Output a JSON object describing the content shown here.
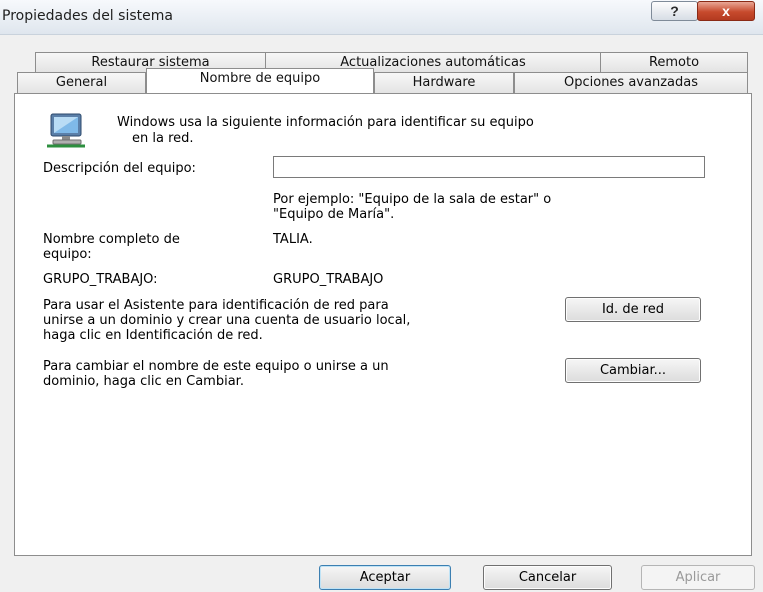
{
  "window": {
    "title": "Propiedades del sistema"
  },
  "title_buttons": {
    "help": "?",
    "close": "x"
  },
  "tabs_top": [
    "Restaurar sistema",
    "Actualizaciones automáticas",
    "Remoto"
  ],
  "tabs_bottom": [
    "General",
    "Nombre de equipo",
    "Hardware",
    "Opciones avanzadas"
  ],
  "active_tab": "Nombre de equipo",
  "intro": {
    "icon": "computer-network-icon",
    "line1": "Windows usa la siguiente información para identificar su equipo",
    "line2": "en la red."
  },
  "description": {
    "label": "Descripción del equipo:",
    "value": "",
    "example_line1": "Por ejemplo: \"Equipo de la sala de estar\" o",
    "example_line2": "\"Equipo de María\"."
  },
  "full_name": {
    "label_line1": "Nombre completo de",
    "label_line2": "equipo:",
    "value": "TALIA."
  },
  "workgroup": {
    "label": "GRUPO_TRABAJO:",
    "value": "GRUPO_TRABAJO"
  },
  "network_id": {
    "text_line1": "Para usar el Asistente para identificación de red para",
    "text_line2": "unirse a un dominio y crear una cuenta de usuario local,",
    "text_line3": "haga clic en Identificación de red.",
    "button": "Id. de red"
  },
  "change": {
    "text_line1": "Para cambiar el nombre de este equipo o unirse a un",
    "text_line2": "dominio, haga clic en Cambiar.",
    "button": "Cambiar..."
  },
  "footer": {
    "ok": "Aceptar",
    "cancel": "Cancelar",
    "apply": "Aplicar"
  },
  "colors": {
    "close_button": "#c74a2d",
    "window_bg": "#f0f0f0",
    "default_button_border": "#3c7fb1"
  }
}
